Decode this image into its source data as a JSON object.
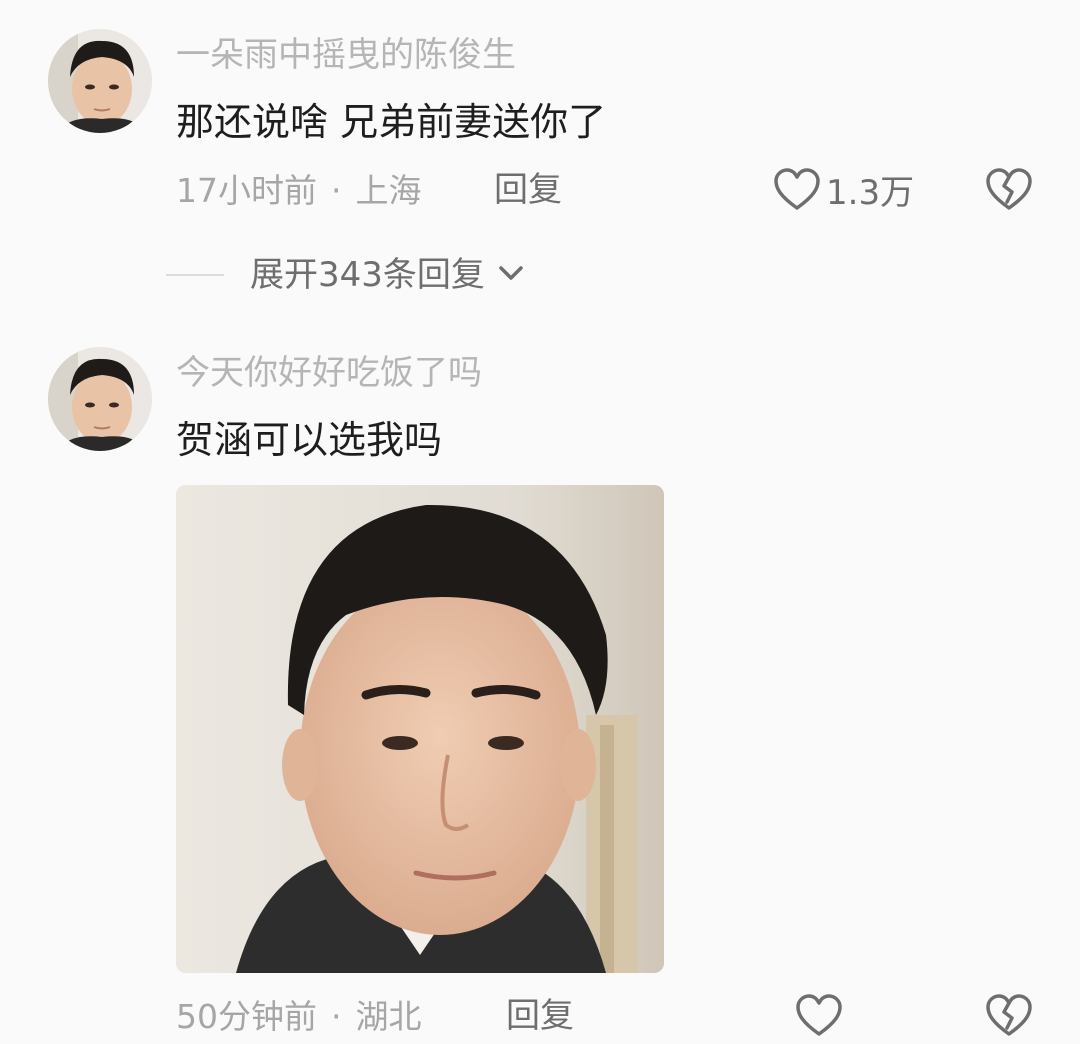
{
  "comments": [
    {
      "username": "一朵雨中摇曳的陈俊生",
      "content": "那还说啥 兄弟前妻送你了",
      "time": "17小时前",
      "location": "上海",
      "reply_label": "回复",
      "like_count": "1.3万",
      "expand_label": "展开343条回复"
    },
    {
      "username": "今天你好好吃饭了吗",
      "content": "贺涵可以选我吗",
      "time": "50分钟前",
      "location": "湖北",
      "reply_label": "回复"
    }
  ],
  "separator": "·",
  "colors": {
    "background": "#fafafa",
    "username": "#b5b5b5",
    "content": "#1e1e1e",
    "meta": "#a6a6a6",
    "action": "#6e6e6e"
  },
  "icons": [
    "heart-icon",
    "broken-heart-icon",
    "chevron-down-icon"
  ]
}
